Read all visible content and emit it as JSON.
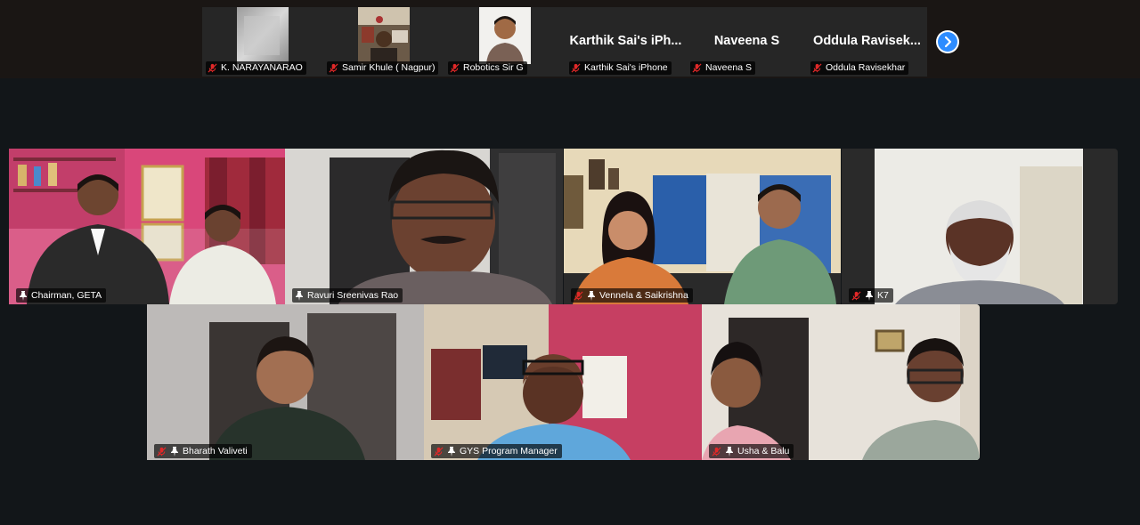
{
  "top_strip": {
    "participants": [
      {
        "label": "K. NARAYANARAO",
        "video": true
      },
      {
        "label": "Samir Khule ( Nagpur)",
        "video": true
      },
      {
        "label": "Robotics Sir G",
        "video": true
      },
      {
        "label": "Karthik Sai's iPhone",
        "display_name": "Karthik  Sai's  iPh...",
        "video": false
      },
      {
        "label": "Naveena S",
        "display_name": "Naveena  S",
        "video": false
      },
      {
        "label": "Oddula Ravisekhar",
        "display_name": "Oddula  Ravisek...",
        "video": false
      }
    ],
    "next_icon": "chevron-right-icon"
  },
  "gallery": {
    "tiles": [
      {
        "label": "Chairman, GETA",
        "pinned": true,
        "muted": false
      },
      {
        "label": "Ravuri Sreenivas Rao",
        "pinned": true,
        "muted": false,
        "active_speaker": true
      },
      {
        "label": "Vennela & Saikrishna",
        "pinned": true,
        "muted": true
      },
      {
        "label": "K7",
        "pinned": true,
        "muted": true
      },
      {
        "label": "Bharath Valiveti",
        "pinned": true,
        "muted": true
      },
      {
        "label": "GYS Program Manager",
        "pinned": true,
        "muted": true
      },
      {
        "label": "Usha & Balu",
        "pinned": true,
        "muted": true
      }
    ]
  },
  "colors": {
    "active_border": "#23d959",
    "muted_icon": "#e02828",
    "next_button": "#2d8cff"
  }
}
